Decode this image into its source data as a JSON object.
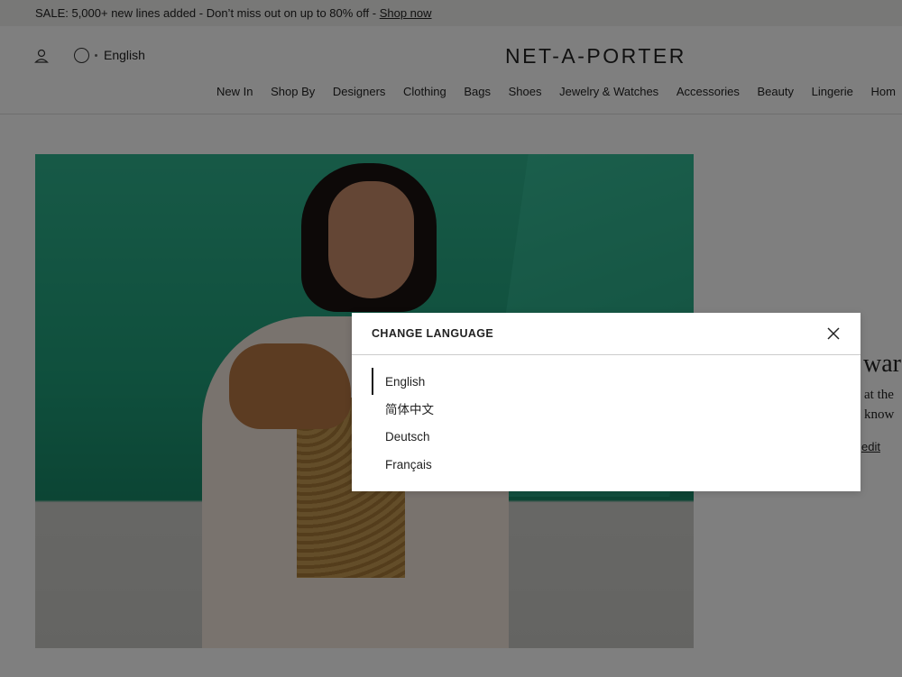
{
  "promo": {
    "text": "SALE: 5,000+ new lines added - Don’t miss out on up to 80% off - ",
    "link": "Shop now"
  },
  "header": {
    "language": "English",
    "logo": "NET-A-PORTER",
    "nav": [
      "New In",
      "Shop By",
      "Designers",
      "Clothing",
      "Bags",
      "Shoes",
      "Jewelry & Watches",
      "Accessories",
      "Beauty",
      "Lingerie",
      "Hom"
    ]
  },
  "side": {
    "title": "war",
    "line1": "at the",
    "line2": "know",
    "link": "edit"
  },
  "modal": {
    "title": "CHANGE LANGUAGE",
    "languages": [
      "English",
      "简体中文",
      "Deutsch",
      "Français"
    ],
    "selected": "English"
  },
  "colors": {
    "overlay": "rgba(0,0,0,0.5)",
    "hero_green": "#1f9f7a"
  },
  "icons": {
    "account": "account-icon",
    "globe": "globe-icon",
    "close": "close-icon"
  }
}
